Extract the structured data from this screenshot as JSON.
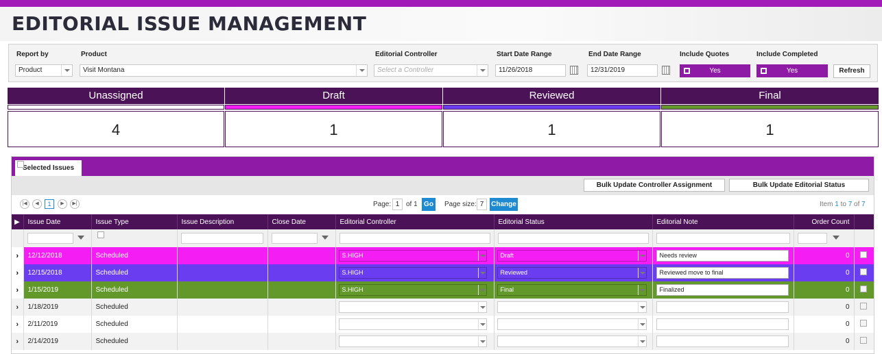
{
  "title": "EDITORIAL ISSUE MANAGEMENT",
  "filters": {
    "report_by_label": "Report by",
    "report_by_value": "Product",
    "product_label": "Product",
    "product_value": "Visit Montana",
    "controller_label": "Editorial Controller",
    "controller_placeholder": "Select a Controller",
    "start_label": "Start Date Range",
    "start_value": "11/26/2018",
    "end_label": "End Date Range",
    "end_value": "12/31/2019",
    "quotes_label": "Include Quotes",
    "quotes_value": "Yes",
    "completed_label": "Include Completed",
    "completed_value": "Yes",
    "refresh_label": "Refresh"
  },
  "status": [
    {
      "label": "Unassigned",
      "count": "4",
      "color": "#ffffff"
    },
    {
      "label": "Draft",
      "count": "1",
      "color": "#f41df4"
    },
    {
      "label": "Reviewed",
      "count": "1",
      "color": "#6a3ef0"
    },
    {
      "label": "Final",
      "count": "1",
      "color": "#63982a"
    }
  ],
  "grid": {
    "tab_label": "Selected Issues",
    "bulk_controller_label": "Bulk Update Controller Assignment",
    "bulk_status_label": "Bulk Update Editorial Status",
    "pager": {
      "current_page": "1",
      "page_label": "Page:",
      "page_value": "1",
      "of_label": "of 1",
      "go_label": "Go",
      "size_label": "Page size:",
      "size_value": "7",
      "change_label": "Change",
      "item_text_prefix": "Item",
      "item_from": "1",
      "item_mid": "to",
      "item_to": "7",
      "item_of": "of",
      "item_total": "7"
    },
    "columns": [
      "Issue Date",
      "Issue Type",
      "Issue Description",
      "Close Date",
      "Editorial Controller",
      "Editorial Status",
      "Editorial Note",
      "Order Count"
    ],
    "rows": [
      {
        "date": "12/12/2018",
        "type": "Scheduled",
        "desc": "",
        "close": "",
        "controller": "S.HIGH",
        "status": "Draft",
        "note": "Needs review",
        "count": "0"
      },
      {
        "date": "12/15/2018",
        "type": "Scheduled",
        "desc": "",
        "close": "",
        "controller": "S.HIGH",
        "status": "Reviewed",
        "note": "Reviewed move to final",
        "count": "0"
      },
      {
        "date": "1/15/2019",
        "type": "Scheduled",
        "desc": "",
        "close": "",
        "controller": "S.HIGH",
        "status": "Final",
        "note": "Finalized",
        "count": "0"
      },
      {
        "date": "1/18/2019",
        "type": "Scheduled",
        "desc": "",
        "close": "",
        "controller": "",
        "status": "",
        "note": "",
        "count": "0"
      },
      {
        "date": "2/11/2019",
        "type": "Scheduled",
        "desc": "",
        "close": "",
        "controller": "",
        "status": "",
        "note": "",
        "count": "0"
      },
      {
        "date": "2/14/2019",
        "type": "Scheduled",
        "desc": "",
        "close": "",
        "controller": "",
        "status": "",
        "note": "",
        "count": "0"
      }
    ]
  }
}
